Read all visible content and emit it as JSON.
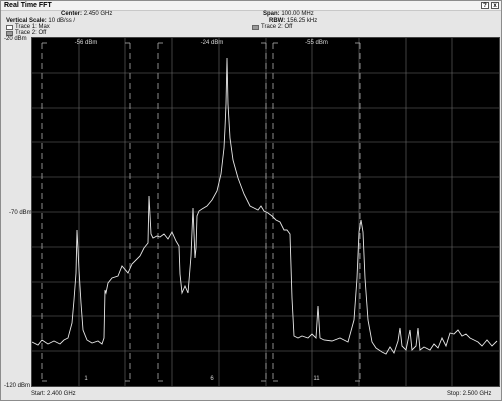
{
  "window": {
    "title": "Real Time FFT",
    "buttons": [
      "?",
      "x"
    ]
  },
  "info": {
    "center_label": "Center:",
    "center_value": "2.450 GHz",
    "vscale_label": "Vertical Scale:",
    "vscale_value": "10 dB/ss /",
    "span_label": "Span:",
    "span_value": "100.00 MHz",
    "rbw_label": "RBW:",
    "rbw_value": "156.25 kHz"
  },
  "legend": {
    "trace1": "Trace 1: Max",
    "trace2_left": "Trace 2: Off",
    "trace2_right": "Trace 2: Off"
  },
  "axis": {
    "y_top": "-20 dBm",
    "y_mid": "-70 dBm",
    "y_bottom": "-120 dBm",
    "start": "Start: 2.400 GHz",
    "stop": "Stop: 2.500 GHz"
  },
  "channels": [
    {
      "label": "1",
      "level": "-56 dBm"
    },
    {
      "label": "6",
      "level": "-24 dBm"
    },
    {
      "label": "11",
      "level": "-55 dBm"
    }
  ],
  "colors": {
    "plot_bg": "#000000",
    "grid": "#6e6e6e",
    "trace": "#e8e8e8",
    "channel_marker": "#b0b0b0"
  }
}
